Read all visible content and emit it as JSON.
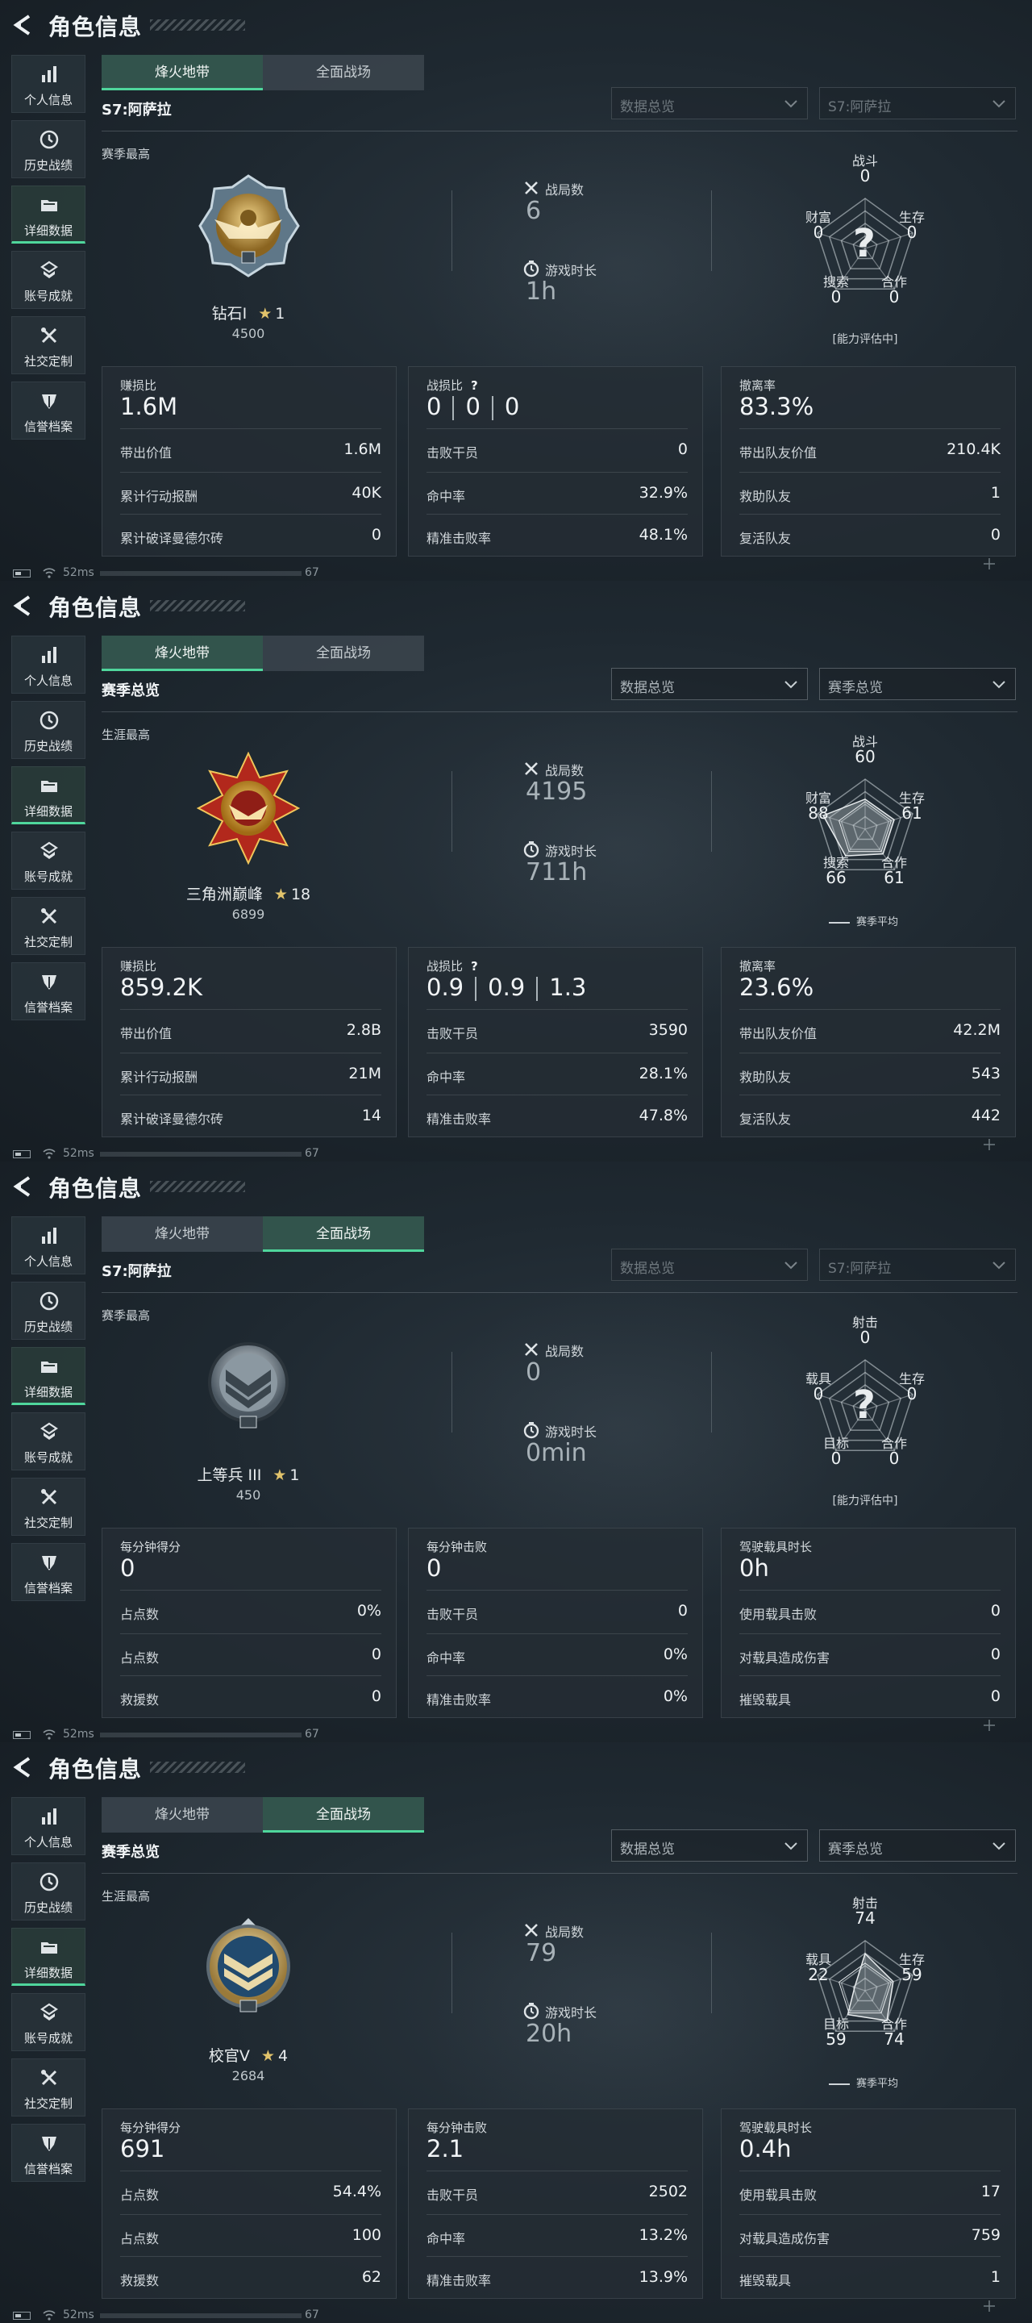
{
  "common": {
    "page_title": "角色信息",
    "sidebar": [
      "个人信息",
      "历史战绩",
      "详细数据",
      "账号成就",
      "社交定制",
      "信誉档案"
    ],
    "active_sidebar_index": 2,
    "mode_tabs": [
      "烽火地带",
      "全面战场"
    ],
    "ping": "52ms",
    "fps": "67",
    "accent_color": "#4fd69c"
  },
  "panels": [
    {
      "active_tab": 0,
      "heading": "S7:阿萨拉",
      "heading_style": "season",
      "dropdown1": "数据总览",
      "dropdown2": "S7:阿萨拉",
      "dropdowns_dim": true,
      "best_label": "赛季最高",
      "badge": "diamond-eagle-badge",
      "rank_name": "钻石I",
      "rank_stars": "1",
      "rank_score": "4500",
      "stat1_label": "战局数",
      "stat1_value": "6",
      "stat2_label": "游戏时长",
      "stat2_value": "1h",
      "radar": {
        "labels": [
          "战斗",
          "生存",
          "合作",
          "搜索",
          "财富"
        ],
        "values": [
          "0",
          "0",
          "0",
          "0",
          "0"
        ],
        "fractions": [
          0,
          0,
          0,
          0,
          0
        ],
        "pending": true,
        "note": "[能力评估中]",
        "qmark": "?"
      },
      "cards": [
        {
          "head": "赚损比",
          "big": "1.6M",
          "rows": [
            [
              "带出价值",
              "1.6M"
            ],
            [
              "累计行动报酬",
              "40K"
            ],
            [
              "累计破译曼德尔砖",
              "0"
            ]
          ]
        },
        {
          "head": "战损比",
          "help": "?",
          "triple": [
            "0",
            "0",
            "0"
          ],
          "rows": [
            [
              "击败干员",
              "0"
            ],
            [
              "命中率",
              "32.9%"
            ],
            [
              "精准击败率",
              "48.1%"
            ]
          ]
        },
        {
          "head": "撤离率",
          "big": "83.3%",
          "rows": [
            [
              "带出队友价值",
              "210.4K"
            ],
            [
              "救助队友",
              "1"
            ],
            [
              "复活队友",
              "0"
            ]
          ]
        }
      ]
    },
    {
      "active_tab": 0,
      "heading": "赛季总览",
      "dropdown1": "数据总览",
      "dropdown2": "赛季总览",
      "dropdowns_dim": false,
      "best_label": "生涯最高",
      "badge": "triangle-peak-red-badge",
      "rank_name": "三角洲巅峰",
      "rank_stars": "18",
      "rank_score": "6899",
      "stat1_label": "战局数",
      "stat1_value": "4195",
      "stat2_label": "游戏时长",
      "stat2_value": "711h",
      "radar": {
        "labels": [
          "战斗",
          "生存",
          "合作",
          "搜索",
          "财富"
        ],
        "values": [
          "60",
          "61",
          "61",
          "66",
          "88"
        ],
        "fractions": [
          0.6,
          0.61,
          0.61,
          0.66,
          0.88
        ],
        "pending": false,
        "legend": "赛季平均"
      },
      "cards": [
        {
          "head": "赚损比",
          "big": "859.2K",
          "rows": [
            [
              "带出价值",
              "2.8B"
            ],
            [
              "累计行动报酬",
              "21M"
            ],
            [
              "累计破译曼德尔砖",
              "14"
            ]
          ]
        },
        {
          "head": "战损比",
          "help": "?",
          "triple": [
            "0.9",
            "0.9",
            "1.3"
          ],
          "rows": [
            [
              "击败干员",
              "3590"
            ],
            [
              "命中率",
              "28.1%"
            ],
            [
              "精准击败率",
              "47.8%"
            ]
          ]
        },
        {
          "head": "撤离率",
          "big": "23.6%",
          "rows": [
            [
              "带出队友价值",
              "42.2M"
            ],
            [
              "救助队友",
              "543"
            ],
            [
              "复活队友",
              "442"
            ]
          ]
        }
      ]
    },
    {
      "active_tab": 1,
      "heading": "S7:阿萨拉",
      "dropdown1": "数据总览",
      "dropdown2": "S7:阿萨拉",
      "dropdowns_dim": true,
      "best_label": "赛季最高",
      "badge": "private-chevron-badge",
      "rank_name": "上等兵 III",
      "rank_stars": "1",
      "rank_score": "450",
      "stat1_label": "战局数",
      "stat1_value": "0",
      "stat2_label": "游戏时长",
      "stat2_value": "0min",
      "radar": {
        "labels": [
          "射击",
          "生存",
          "合作",
          "目标",
          "载具"
        ],
        "values": [
          "0",
          "0",
          "0",
          "0",
          "0"
        ],
        "fractions": [
          0,
          0,
          0,
          0,
          0
        ],
        "pending": true,
        "note": "[能力评估中]",
        "qmark": "?"
      },
      "cards": [
        {
          "head": "每分钟得分",
          "big": "0",
          "rows": [
            [
              "占点数",
              "0%"
            ],
            [
              "占点数",
              "0"
            ],
            [
              "救援数",
              "0"
            ]
          ]
        },
        {
          "head": "每分钟击败",
          "big": "0",
          "rows": [
            [
              "击败干员",
              "0"
            ],
            [
              "命中率",
              "0%"
            ],
            [
              "精准击败率",
              "0%"
            ]
          ]
        },
        {
          "head": "驾驶载具时长",
          "big": "0h",
          "rows": [
            [
              "使用载具击败",
              "0"
            ],
            [
              "对载具造成伤害",
              "0"
            ],
            [
              "摧毁载具",
              "0"
            ]
          ]
        }
      ]
    },
    {
      "active_tab": 1,
      "heading": "赛季总览",
      "dropdown1": "数据总览",
      "dropdown2": "赛季总览",
      "dropdowns_dim": false,
      "best_label": "生涯最高",
      "badge": "officer-gold-badge",
      "rank_name": "校官V",
      "rank_stars": "4",
      "rank_score": "2684",
      "stat1_label": "战局数",
      "stat1_value": "79",
      "stat2_label": "游戏时长",
      "stat2_value": "20h",
      "radar": {
        "labels": [
          "射击",
          "生存",
          "合作",
          "目标",
          "载具"
        ],
        "values": [
          "74",
          "59",
          "74",
          "59",
          "22"
        ],
        "fractions": [
          0.74,
          0.59,
          0.74,
          0.59,
          0.22
        ],
        "pending": false,
        "legend": "赛季平均"
      },
      "cards": [
        {
          "head": "每分钟得分",
          "big": "691",
          "rows": [
            [
              "占点数",
              "54.4%"
            ],
            [
              "占点数",
              "100"
            ],
            [
              "救援数",
              "62"
            ]
          ]
        },
        {
          "head": "每分钟击败",
          "big": "2.1",
          "rows": [
            [
              "击败干员",
              "2502"
            ],
            [
              "命中率",
              "13.2%"
            ],
            [
              "精准击败率",
              "13.9%"
            ]
          ]
        },
        {
          "head": "驾驶载具时长",
          "big": "0.4h",
          "rows": [
            [
              "使用载具击败",
              "17"
            ],
            [
              "对载具造成伤害",
              "759"
            ],
            [
              "摧毁载具",
              "1"
            ]
          ]
        }
      ]
    }
  ]
}
